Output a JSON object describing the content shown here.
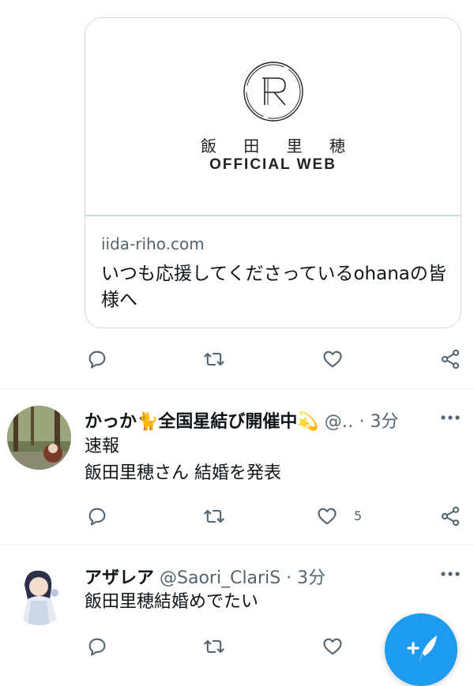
{
  "card": {
    "logo_name": "飯 田 里 穂",
    "logo_sub": "OFFICIAL WEB",
    "domain": "iida-riho.com",
    "description": "いつも応援してくださっているohanaの皆様へ"
  },
  "tweets": [
    {
      "display_name": "かっか🐈全国星結び開催中💫",
      "meta": "@‥ · 3分",
      "text_line1": "速報",
      "text_line2": "飯田里穂さん 結婚を発表",
      "like_count": "5"
    },
    {
      "display_name": "アザレア",
      "meta": "@Saori_ClariS · 3分",
      "text_line1": "飯田里穂結婚めでたい",
      "like_count": ""
    }
  ],
  "colors": {
    "accent": "#1d9bf0",
    "text": "#0f1419",
    "secondary": "#536471",
    "border": "#cfd9de"
  },
  "icons": [
    "reply-icon",
    "retweet-icon",
    "like-icon",
    "share-icon",
    "more-icon",
    "compose-icon"
  ]
}
